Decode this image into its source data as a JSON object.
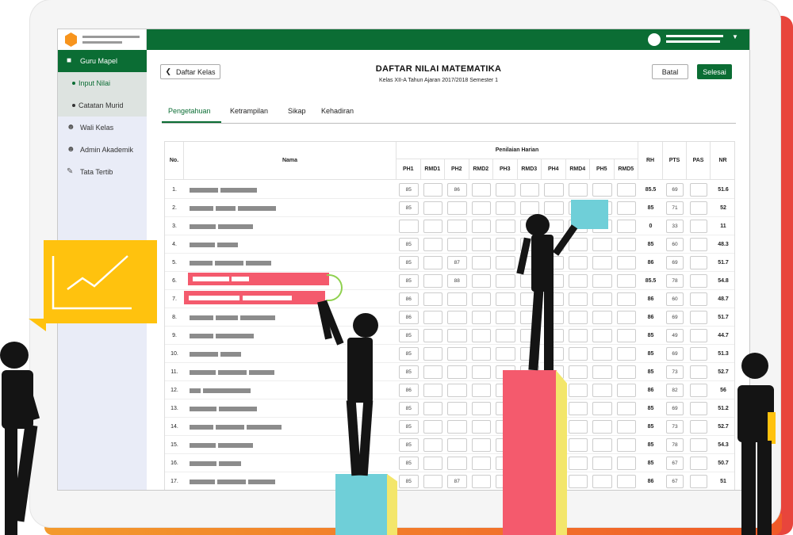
{
  "sidebar": {
    "items": [
      {
        "label": "Guru Mapel",
        "icon": "teacher-icon",
        "active": true
      },
      {
        "label": "Input Nilai",
        "sub": true,
        "current": true
      },
      {
        "label": "Catatan Murid",
        "sub": true
      },
      {
        "label": "Wali Kelas",
        "icon": "users-icon"
      },
      {
        "label": "Admin Akademik",
        "icon": "admin-icon"
      },
      {
        "label": "Tata Tertib",
        "icon": "rules-icon"
      }
    ]
  },
  "header": {
    "back_label": "Daftar Kelas",
    "title": "DAFTAR NILAI MATEMATIKA",
    "subtitle": "Kelas XII-A Tahun Ajaran 2017/2018 Semester 1",
    "cancel_label": "Batal",
    "done_label": "Selesai"
  },
  "tabs": [
    {
      "label": "Pengetahuan",
      "active": true
    },
    {
      "label": "Ketrampilan"
    },
    {
      "label": "Sikap"
    },
    {
      "label": "Kehadiran"
    }
  ],
  "table": {
    "col_no": "No.",
    "col_name": "Nama",
    "group_header": "Penilaian Harian",
    "sub_columns": [
      "PH1",
      "RMD1",
      "PH2",
      "RMD2",
      "PH3",
      "RMD3",
      "PH4",
      "RMD4",
      "PH5",
      "RMD5"
    ],
    "col_rh": "RH",
    "col_pts": "PTS",
    "col_pas": "PAS",
    "col_nr": "NR",
    "rows": [
      {
        "no": "1.",
        "ph1": "85",
        "ph2": "86",
        "rh": "85.5",
        "pts": "69",
        "nr": "51.6"
      },
      {
        "no": "2.",
        "ph1": "85",
        "ph2": "",
        "rh": "85",
        "pts": "71",
        "nr": "52"
      },
      {
        "no": "3.",
        "ph1": "",
        "ph2": "",
        "rh": "0",
        "pts": "33",
        "nr": "11"
      },
      {
        "no": "4.",
        "ph1": "85",
        "ph2": "",
        "rh": "85",
        "pts": "60",
        "nr": "48.3"
      },
      {
        "no": "5.",
        "ph1": "85",
        "ph2": "87",
        "rh": "86",
        "pts": "69",
        "nr": "51.7"
      },
      {
        "no": "6.",
        "ph1": "85",
        "ph2": "88",
        "rh": "85.5",
        "pts": "78",
        "nr": "54.8"
      },
      {
        "no": "7.",
        "ph1": "86",
        "ph2": "",
        "rh": "86",
        "pts": "60",
        "nr": "48.7"
      },
      {
        "no": "8.",
        "ph1": "86",
        "ph2": "",
        "rh": "86",
        "pts": "69",
        "nr": "51.7"
      },
      {
        "no": "9.",
        "ph1": "85",
        "ph2": "",
        "rh": "85",
        "pts": "49",
        "nr": "44.7"
      },
      {
        "no": "10.",
        "ph1": "85",
        "ph2": "",
        "rh": "85",
        "pts": "69",
        "nr": "51.3"
      },
      {
        "no": "11.",
        "ph1": "85",
        "ph2": "",
        "rh": "85",
        "pts": "73",
        "nr": "52.7"
      },
      {
        "no": "12.",
        "ph1": "86",
        "ph2": "",
        "rh": "86",
        "pts": "82",
        "nr": "56"
      },
      {
        "no": "13.",
        "ph1": "85",
        "ph2": "",
        "rh": "85",
        "pts": "69",
        "nr": "51.2"
      },
      {
        "no": "14.",
        "ph1": "85",
        "ph2": "",
        "rh": "85",
        "pts": "73",
        "nr": "52.7"
      },
      {
        "no": "15.",
        "ph1": "85",
        "ph2": "",
        "rh": "85",
        "pts": "78",
        "nr": "54.3"
      },
      {
        "no": "16.",
        "ph1": "85",
        "ph2": "",
        "rh": "85",
        "pts": "67",
        "nr": "50.7"
      },
      {
        "no": "17.",
        "ph1": "85",
        "ph2": "87",
        "rh": "86",
        "pts": "67",
        "nr": "51"
      }
    ]
  },
  "colors": {
    "brand_green": "#0b6d34",
    "accent_orange": "#f7941d",
    "highlight_red": "#f45a6d",
    "accent_cyan": "#6fcfd8",
    "accent_yellow": "#ffc20e",
    "pillar_yellow": "#f3e66b"
  }
}
